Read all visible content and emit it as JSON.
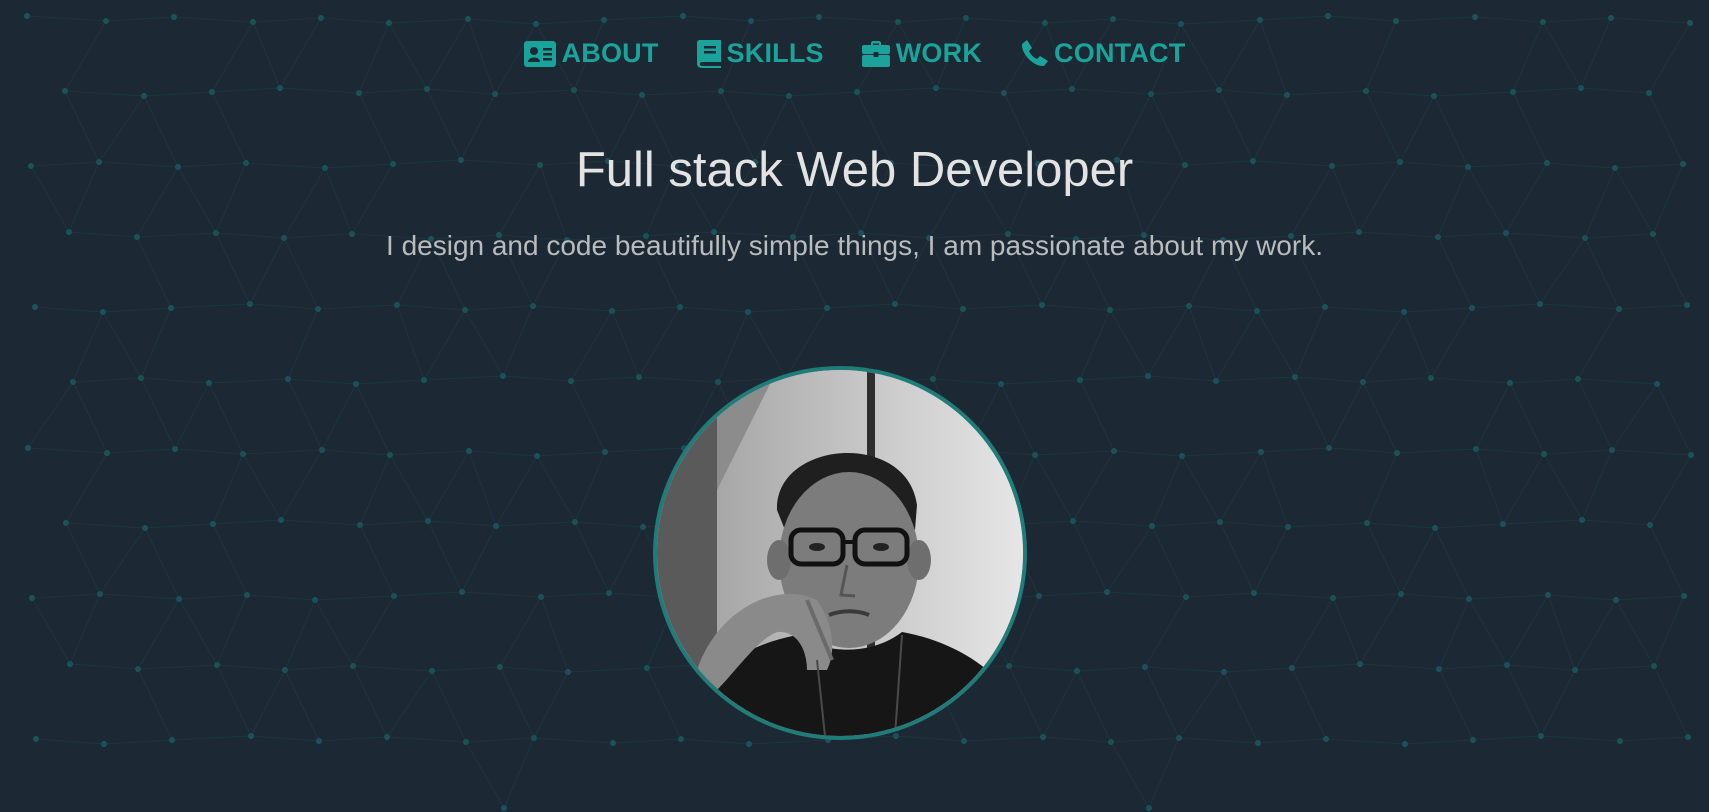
{
  "nav": {
    "items": [
      {
        "label": "ABOUT",
        "icon": "id-card-icon"
      },
      {
        "label": "SKILLS",
        "icon": "book-icon"
      },
      {
        "label": "WORK",
        "icon": "briefcase-icon"
      },
      {
        "label": "CONTACT",
        "icon": "phone-icon"
      }
    ]
  },
  "hero": {
    "title": "Full stack Web Developer",
    "subtitle": "I design and code beautifully simple things, I am passionate about my work."
  },
  "colors": {
    "background": "#1c2833",
    "accent": "#1aa39a",
    "title": "#e3e3e3",
    "subtitle": "#b9bcbf",
    "avatar_border": "#1f7c78"
  }
}
